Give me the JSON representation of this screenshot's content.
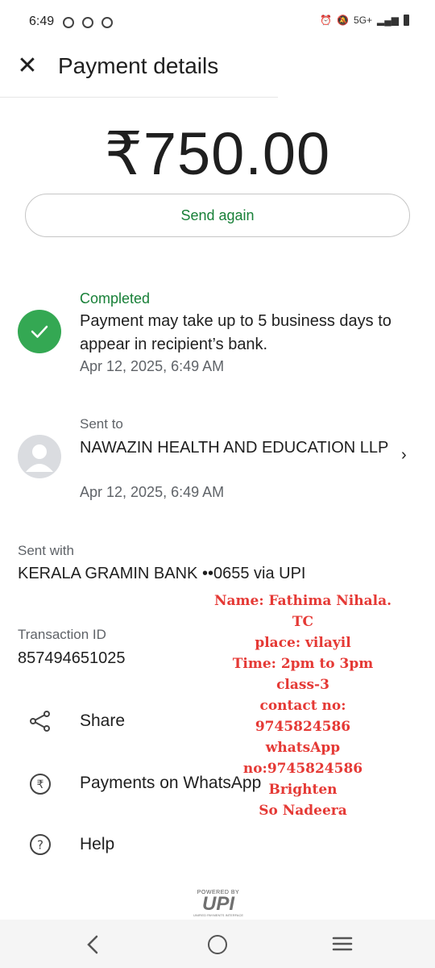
{
  "status_bar": {
    "time": "6:49",
    "network": "5G+"
  },
  "header": {
    "title": "Payment details",
    "close_icon": "close-icon"
  },
  "payment": {
    "amount": "₹750.00",
    "send_again_label": "Send again"
  },
  "status": {
    "label": "Completed",
    "message": "Payment may take up to 5 business days to appear in recipient’s bank.",
    "date": "Apr 12, 2025, 6:49 AM",
    "color": "#34a853"
  },
  "recipient": {
    "label": "Sent to",
    "name": "NAWAZIN HEALTH AND EDUCATION LLP",
    "date": "Apr 12, 2025, 6:49 AM"
  },
  "sent_with": {
    "label": "Sent with",
    "value": "KERALA GRAMIN BANK ••0655 via UPI"
  },
  "transaction": {
    "label": "Transaction ID",
    "value": "857494651025"
  },
  "actions": {
    "share": "Share",
    "payments_whatsapp": "Payments on WhatsApp",
    "help": "Help"
  },
  "note": {
    "lines": [
      "Name: Fathima Nihala.",
      "TC",
      "place: vilayil",
      "Time: 2pm to 3pm",
      "class-3",
      "contact no:",
      "9745824586",
      "whatsApp",
      "no:9745824586",
      "Brighten",
      "So Nadeera"
    ],
    "color": "#e53935"
  },
  "footer": {
    "powered_by": "POWERED BY",
    "upi": "UPI",
    "upi_sub": "UNIFIED PAYMENTS INTERFACE"
  },
  "colors": {
    "accent": "#188038",
    "success": "#34a853"
  }
}
